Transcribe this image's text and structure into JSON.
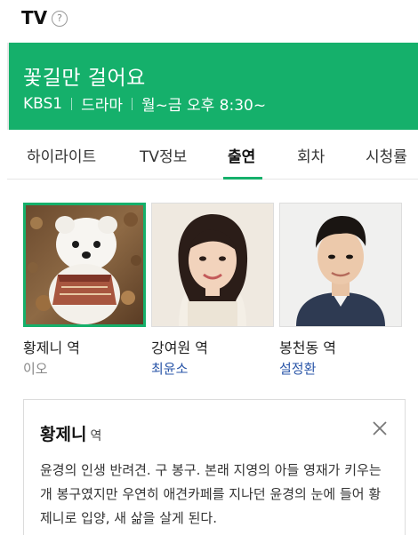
{
  "header": {
    "title": "TV",
    "help_label": "?"
  },
  "program": {
    "title": "꽃길만 걸어요",
    "channel": "KBS1",
    "genre": "드라마",
    "schedule": "월~금 오후 8:30~"
  },
  "tabs": [
    {
      "label": "하이라이트"
    },
    {
      "label": "TV정보"
    },
    {
      "label": "출연"
    },
    {
      "label": "회차"
    },
    {
      "label": "시청률"
    }
  ],
  "active_tab": "출연",
  "cast": [
    {
      "role": "황제니 역",
      "actor": "이오"
    },
    {
      "role": "강여원 역",
      "actor": "최윤소"
    },
    {
      "role": "봉천동 역",
      "actor": "설정환"
    }
  ],
  "detail": {
    "name": "황제니",
    "suffix": "역",
    "description": "윤경의 인생 반려견. 구 봉구. 본래 지영의 아들 영재가 키우는 개 봉구였지만 우연히 애견카페를 지나던 윤경의 눈에 들어 황제니로 입양, 새 삶을 살게 된다."
  },
  "colors": {
    "accent": "#15b06b",
    "link": "#2a56a8"
  },
  "icons": {
    "help": "question-circle-icon",
    "close": "close-icon"
  }
}
